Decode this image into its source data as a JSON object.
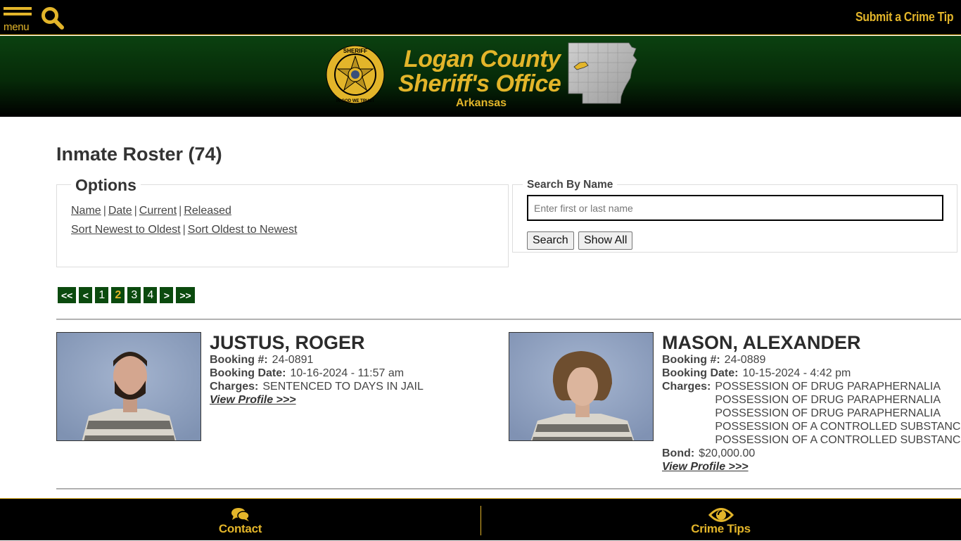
{
  "topbar": {
    "menu_label": "menu",
    "menu_icon": "hamburger-icon",
    "search_icon": "search-icon",
    "crime_tip_link": "Submit a Crime Tip"
  },
  "banner": {
    "line1": "Logan County",
    "line2": "Sheriff's Office",
    "state": "Arkansas",
    "badge_top_text": "SHERIFF",
    "badge_bottom_text": "IN GOD WE TRUST"
  },
  "colors": {
    "accent": "#e3b52a",
    "brand_green": "#0b4a0e",
    "black": "#000000"
  },
  "main": {
    "title": "Inmate Roster (74)",
    "options": {
      "legend": "Options",
      "filters": [
        "Name",
        "Date",
        "Current",
        "Released"
      ],
      "sorts": [
        "Sort Newest to Oldest",
        "Sort Oldest to Newest"
      ],
      "separator": "|"
    },
    "search": {
      "legend": "Search By Name",
      "placeholder": "Enter first or last name",
      "value": "",
      "search_button": "Search",
      "show_all_button": "Show All"
    },
    "pagination": {
      "first": "<<",
      "prev": "<",
      "pages": [
        "1",
        "2",
        "3",
        "4"
      ],
      "current": "2",
      "next": ">",
      "last": ">>"
    },
    "inmates": [
      {
        "name": "JUSTUS, ROGER",
        "booking_label": "Booking #:",
        "booking_number": "24-0891",
        "date_label": "Booking Date:",
        "booking_date": "10-16-2024 - 11:57 am",
        "charges_label": "Charges:",
        "charges": [
          "SENTENCED TO DAYS IN JAIL"
        ],
        "profile_link": "View Profile >>>"
      },
      {
        "name": "MASON, ALEXANDER",
        "booking_label": "Booking #:",
        "booking_number": "24-0889",
        "date_label": "Booking Date:",
        "booking_date": "10-15-2024 - 4:42 pm",
        "charges_label": "Charges:",
        "charges": [
          "POSSESSION OF DRUG PARAPHERNALIA",
          "POSSESSION OF DRUG PARAPHERNALIA",
          "POSSESSION OF DRUG PARAPHERNALIA",
          "POSSESSION OF A CONTROLLED SUBSTANCE",
          "POSSESSION OF A CONTROLLED SUBSTANCE"
        ],
        "bond_label": "Bond:",
        "bond": "$20,000.00",
        "profile_link": "View Profile >>>"
      }
    ]
  },
  "footer": {
    "contact_label": "Contact",
    "contact_icon": "chat-bubbles-icon",
    "tips_label": "Crime Tips",
    "tips_icon": "eye-icon"
  }
}
